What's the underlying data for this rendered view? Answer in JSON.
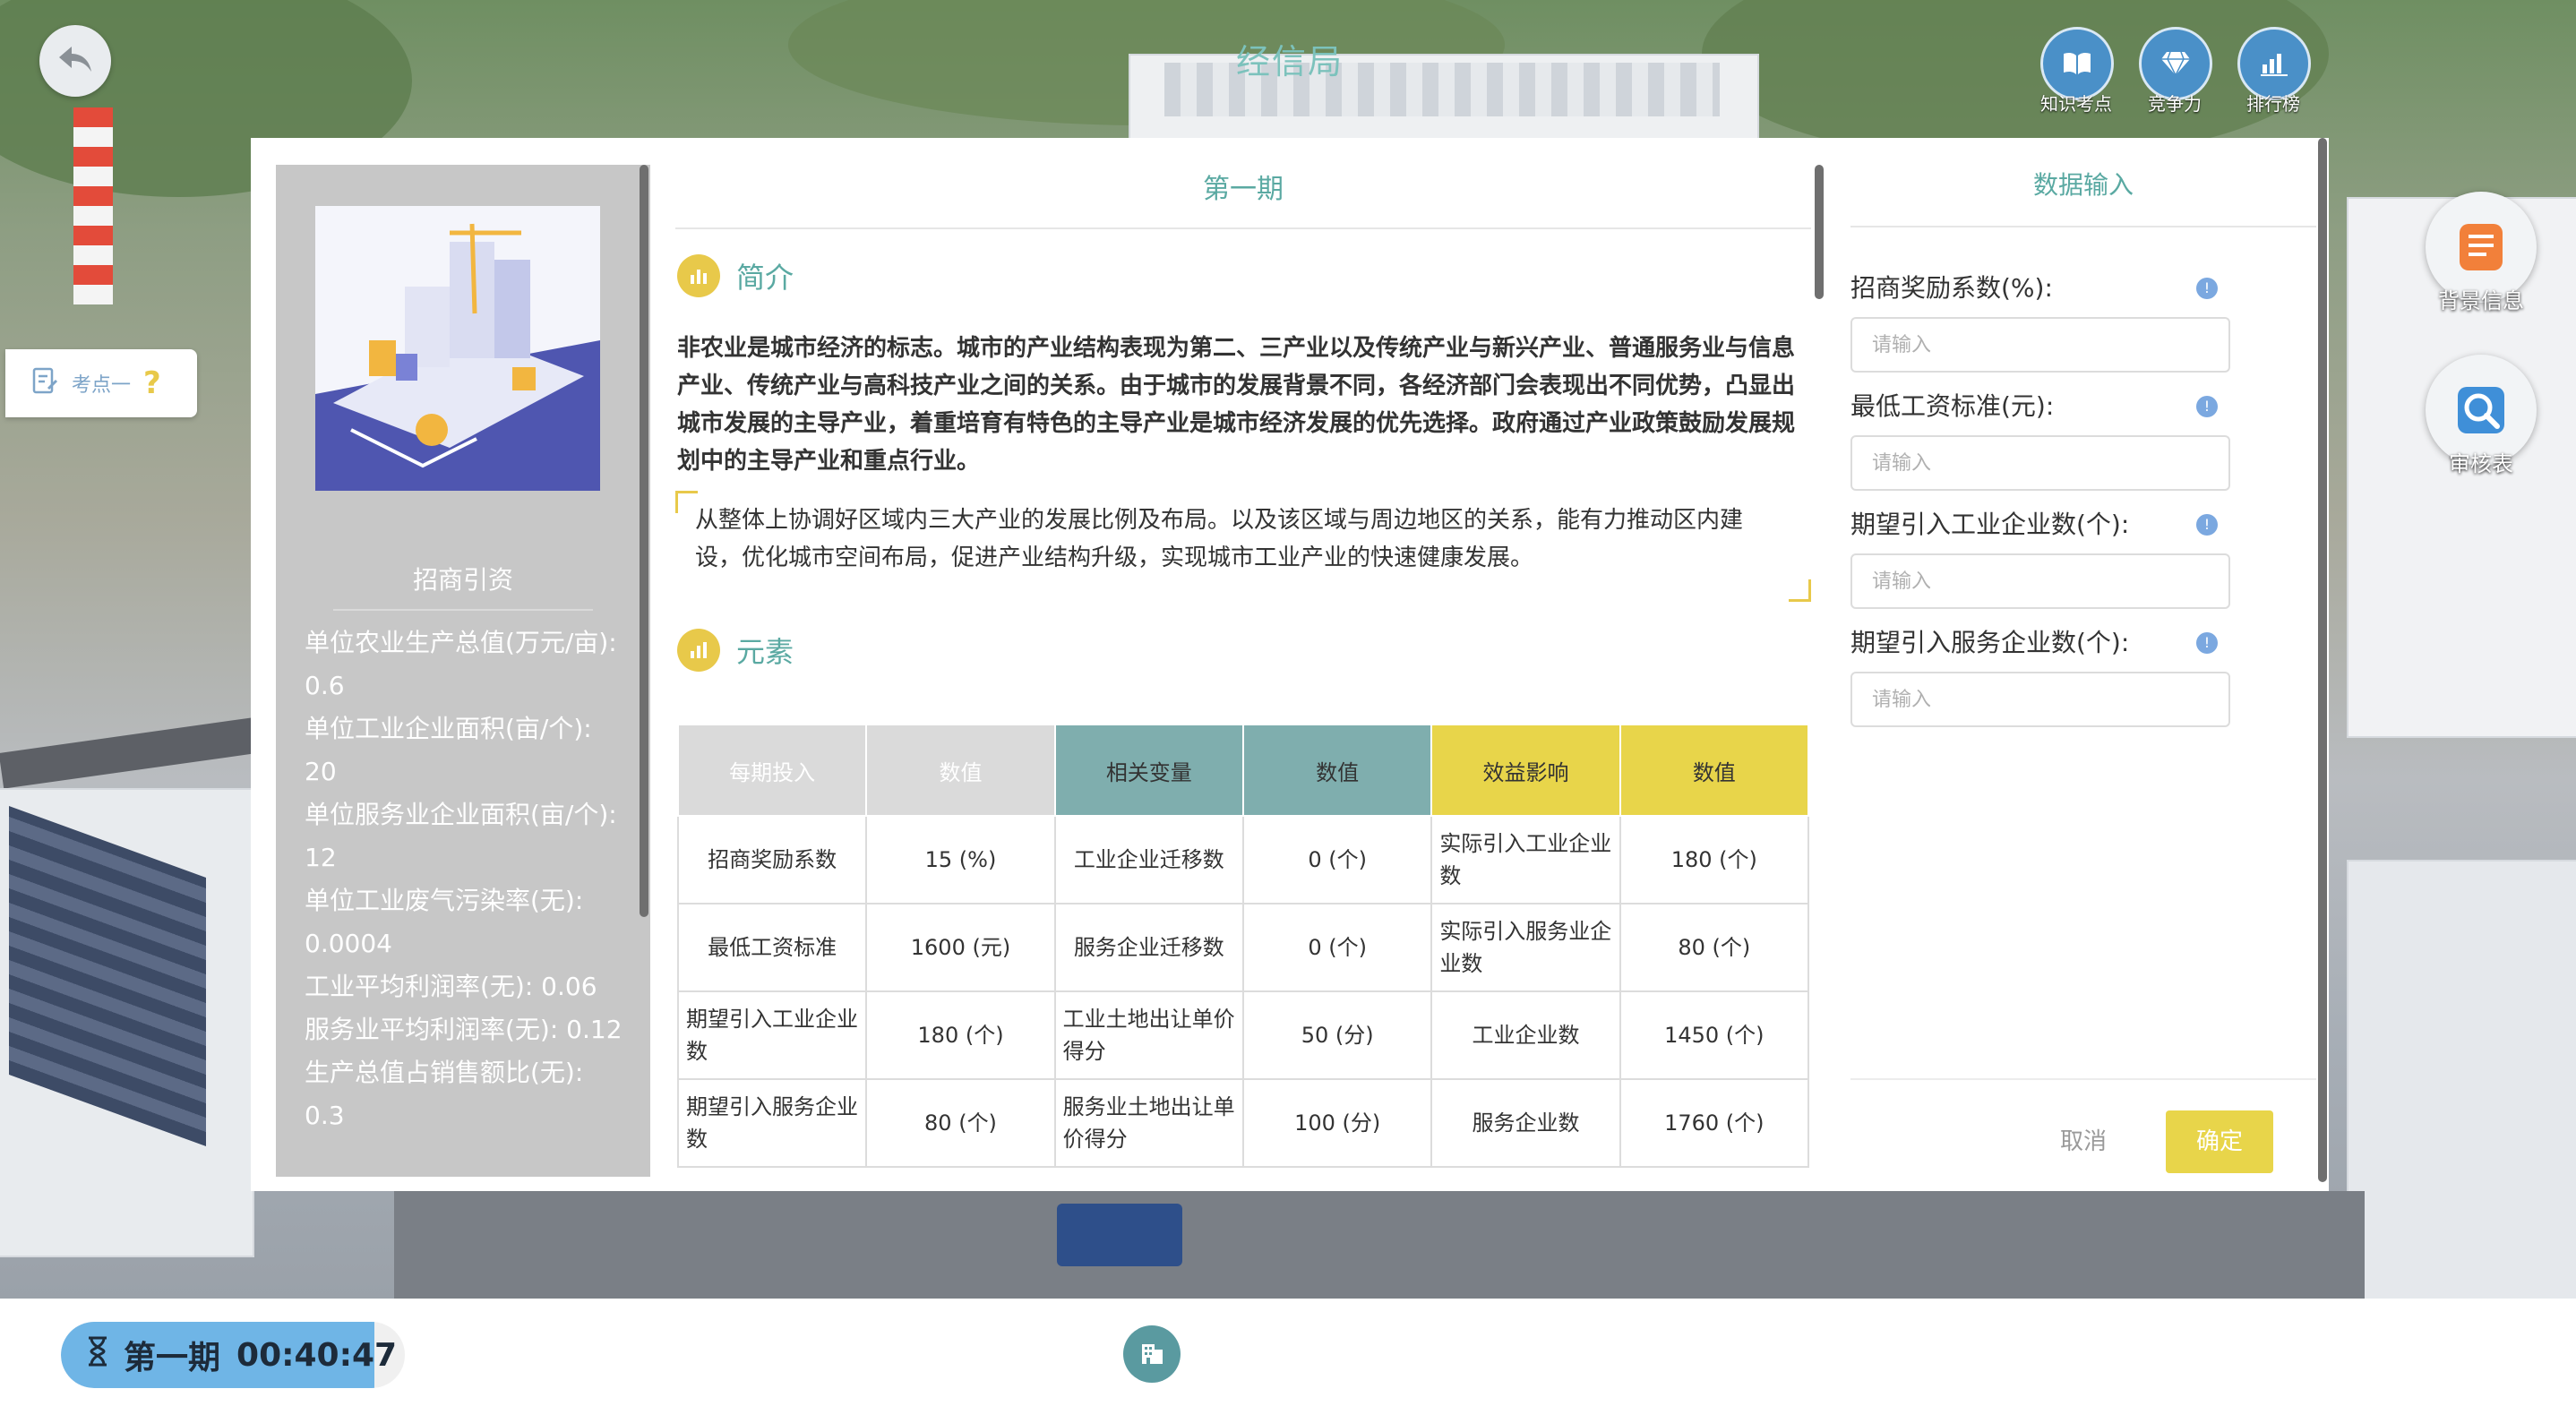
{
  "header": {
    "title": "经信局",
    "icons": [
      {
        "name": "book-icon",
        "label": "知识考点"
      },
      {
        "name": "diamond-icon",
        "label": "竞争力"
      },
      {
        "name": "bar-chart-icon",
        "label": "排行榜"
      }
    ]
  },
  "side_buttons": [
    {
      "name": "document-icon",
      "label": "背景信息"
    },
    {
      "name": "search-icon",
      "label": "审核表"
    }
  ],
  "kaodian": {
    "label": "考点一",
    "icon": "question-icon"
  },
  "left_panel": {
    "title": "招商引资",
    "items": [
      "单位农业生产总值(万元/亩): 0.6",
      "单位工业企业面积(亩/个): 20",
      "单位服务业企业面积(亩/个): 12",
      "单位工业废气污染率(无): 0.0004",
      "工业平均利润率(无): 0.06",
      "服务业平均利润率(无): 0.12",
      "生产总值占销售额比(无): 0.3"
    ]
  },
  "center": {
    "period_title": "第一期",
    "intro_heading": "简介",
    "intro_text": "非农业是城市经济的标志。城市的产业结构表现为第二、三产业以及传统产业与新兴产业、普通服务业与信息产业、传统产业与高科技产业之间的关系。由于城市的发展背景不同，各经济部门会表现出不同优势，凸显出城市发展的主导产业，着重培育有特色的主导产业是城市经济发展的优先选择。政府通过产业政策鼓励发展规划中的主导产业和重点行业。",
    "quote_text": "从整体上协调好区域内三大产业的发展比例及布局。以及该区域与周边地区的关系，能有力推动区内建设，优化城市空间布局，促进产业结构升级，实现城市工业产业的快速健康发展。",
    "elements_heading": "元素",
    "table": {
      "headers": [
        "每期投入",
        "数值",
        "相关变量",
        "数值",
        "效益影响",
        "数值"
      ],
      "rows": [
        [
          "招商奖励系数",
          "15 (%)",
          "工业企业迁移数",
          "0 (个)",
          "实际引入工业企业数",
          "180 (个)"
        ],
        [
          "最低工资标准",
          "1600 (元)",
          "服务企业迁移数",
          "0 (个)",
          "实际引入服务业企业数",
          "80 (个)"
        ],
        [
          "期望引入工业企业数",
          "180 (个)",
          "工业土地出让单价得分",
          "50 (分)",
          "工业企业数",
          "1450 (个)"
        ],
        [
          "期望引入服务企业数",
          "80 (个)",
          "服务业土地出让单价得分",
          "100 (分)",
          "服务企业数",
          "1760 (个)"
        ]
      ]
    }
  },
  "data_input": {
    "title": "数据输入",
    "fields": [
      {
        "label": "招商奖励系数(%):",
        "placeholder": "请输入",
        "value": ""
      },
      {
        "label": "最低工资标准(元):",
        "placeholder": "请输入",
        "value": ""
      },
      {
        "label": "期望引入工业企业数(个):",
        "placeholder": "请输入",
        "value": ""
      },
      {
        "label": "期望引入服务企业数(个):",
        "placeholder": "请输入",
        "value": ""
      }
    ],
    "cancel_label": "取消",
    "confirm_label": "确定",
    "info_glyph": "!"
  },
  "timer": {
    "period": "第一期",
    "time": "00:40:47",
    "icon": "hourglass-icon"
  },
  "colors": {
    "accent_teal": "#5aa9a2",
    "accent_yellow": "#e8d54a",
    "timer_blue": "#6fb5e6"
  }
}
